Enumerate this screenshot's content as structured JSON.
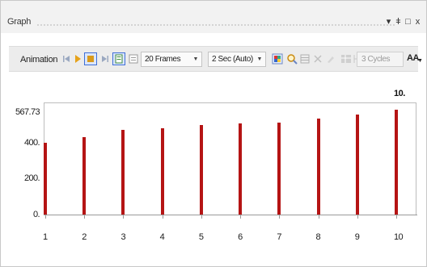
{
  "window": {
    "title": "Graph",
    "buttons": {
      "pin": "▾",
      "dock": "ǂ",
      "maximize": "□",
      "close": "x"
    }
  },
  "toolbar": {
    "animation_label": "Animation",
    "frames_value": "20 Frames",
    "duration_value": "2 Sec (Auto)",
    "cycles_placeholder": "3 Cycles",
    "font_size_label": "AA"
  },
  "colors": {
    "bar": "#b51414",
    "play": "#e6a21a",
    "stop": "#d99a1b",
    "highlight_border": "#3f6fd6"
  },
  "chart_data": {
    "type": "bar",
    "x": [
      1,
      2,
      3,
      4,
      5,
      6,
      7,
      8,
      9,
      10
    ],
    "values": [
      400,
      430,
      470,
      480,
      495,
      505,
      510,
      530,
      555,
      580
    ],
    "y_tick_labels": [
      "0.",
      "200.",
      "400.",
      "567.73"
    ],
    "y_ticks": [
      0,
      200,
      400,
      567.73
    ],
    "x_tick_labels": [
      "1",
      "2",
      "3",
      "4",
      "5",
      "6",
      "7",
      "8",
      "9",
      "10"
    ],
    "ylim": [
      0,
      567.73
    ],
    "peak_label": "10.",
    "grid": false
  }
}
